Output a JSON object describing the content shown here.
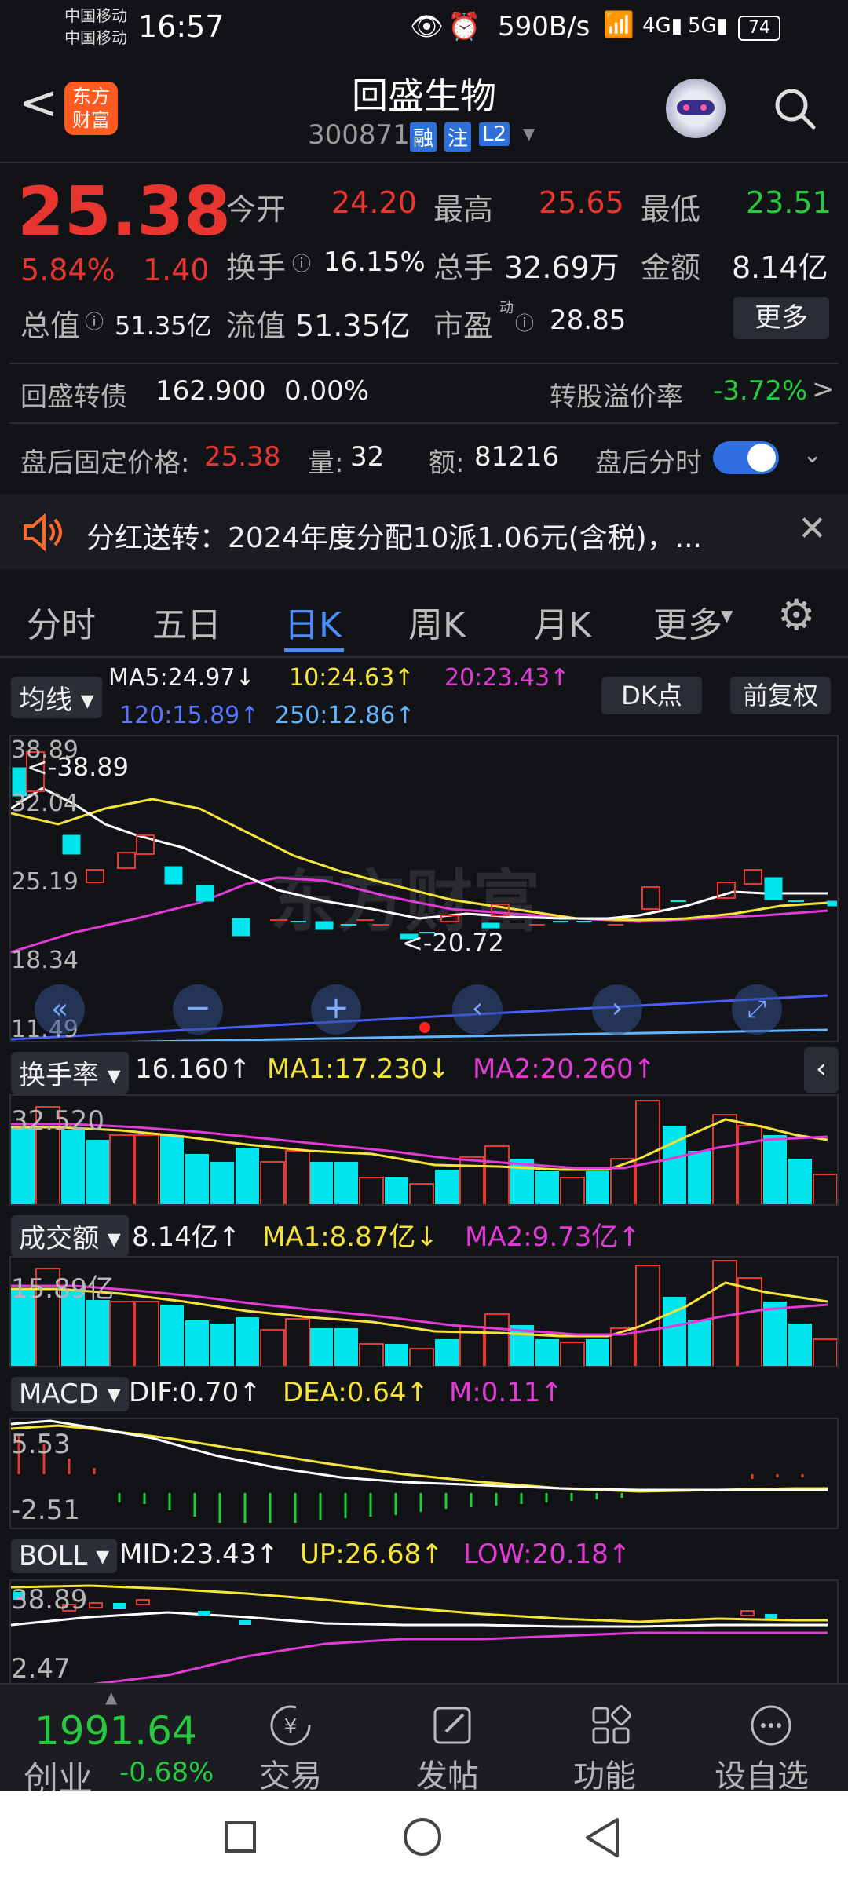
{
  "status": {
    "carrier1": "中国移动",
    "carrier2": "中国移动",
    "time": "16:57",
    "net_speed": "590B/s",
    "battery": "74"
  },
  "header": {
    "back_label": "<",
    "logo_text": "东方财富",
    "title": "回盛生物",
    "code": "300871",
    "badge1": "融",
    "badge2": "注",
    "badge3": "L2"
  },
  "quote": {
    "price": "25.38",
    "change_pct": "5.84%",
    "change": "1.40",
    "open_label": "今开",
    "open": "24.20",
    "high_label": "最高",
    "high": "25.65",
    "low_label": "最低",
    "low": "23.51",
    "turnover_label": "换手",
    "turnover": "16.15%",
    "volume_label": "总手",
    "volume": "32.69万",
    "amount_label": "金额",
    "amount": "8.14亿",
    "mktcap_label": "总值",
    "mktcap": "51.35亿",
    "float_label": "流值",
    "float": "51.35亿",
    "pe_label": "市盈",
    "pe_sup": "动",
    "pe": "28.85",
    "more_btn": "更多"
  },
  "bond": {
    "label": "回盛转债",
    "price": "162.900",
    "pct": "0.00%",
    "premium_label": "转股溢价率",
    "premium": "-3.72%"
  },
  "afterhours": {
    "label": "盘后固定价格:",
    "price": "25.38",
    "vol_label": "量:",
    "vol": "32",
    "amt_label": "额:",
    "amt": "81216",
    "toggle_label": "盘后分时"
  },
  "notice": {
    "text": "分红送转：2024年度分配10派1.06元(含税)，..."
  },
  "tabs": [
    "分时",
    "五日",
    "日K",
    "周K",
    "月K",
    "更多"
  ],
  "ma": {
    "label": "均线",
    "ma5": "MA5:24.97↓",
    "ma10": "10:24.63↑",
    "ma20": "20:23.43↑",
    "ma120": "120:15.89↑",
    "ma250": "250:12.86↑",
    "dk": "DK点",
    "adj": "前复权"
  },
  "kchart": {
    "y1": "38.89",
    "y2": "32.04",
    "y3": "25.19",
    "y4": "18.34",
    "y5": "11.49",
    "hi_mark": "<-38.89",
    "lo_mark": "<-20.72",
    "watermark": "东方财富"
  },
  "turn": {
    "label": "换手率",
    "v": "16.160↑",
    "ma1": "MA1:17.230↓",
    "ma2": "MA2:20.260↑",
    "ytop": "32.520"
  },
  "amt": {
    "label": "成交额",
    "v": "8.14亿↑",
    "ma1": "MA1:8.87亿↓",
    "ma2": "MA2:9.73亿↑",
    "ytop": "15.89亿"
  },
  "macd": {
    "label": "MACD",
    "dif": "DIF:0.70↑",
    "dea": "DEA:0.64↑",
    "m": "M:0.11↑",
    "ytop": "5.53",
    "ybot": "-2.51"
  },
  "boll": {
    "label": "BOLL",
    "mid": "MID:23.43↑",
    "up": "UP:26.68↑",
    "low": "LOW:20.18↑",
    "ytop": "38.89",
    "ybot": "2.47"
  },
  "bottom": {
    "index_val": "1991.64",
    "index_name": "创业",
    "index_pct": "-0.68%",
    "trade": "交易",
    "post": "发帖",
    "func": "功能",
    "watch": "设自选"
  },
  "colors": {
    "up": "#e8352f",
    "down": "#00e5ee",
    "ma5": "#ffffff",
    "ma10": "#f6e33a",
    "ma20": "#e23ad6",
    "ma120": "#4a5cff",
    "ma250": "#62b4ff"
  }
}
